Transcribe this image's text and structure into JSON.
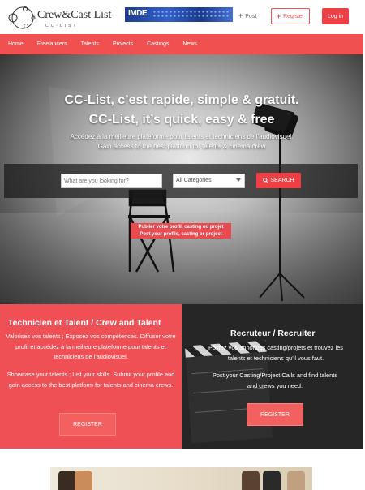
{
  "header": {
    "logo_title": "Crew&Cast List",
    "logo_sub": "CC-LIST",
    "banner_text": "IMDE",
    "post_label": "Post",
    "register_label": "Register",
    "login_label": "Log in"
  },
  "nav": {
    "items": [
      "Home",
      "Freelancers",
      "Talents",
      "Projects",
      "Castings",
      "News"
    ]
  },
  "hero": {
    "title_fr": "CC-List, c’est rapide, simple & gratuit.",
    "title_en": "CC-List, it’s quick, easy & free",
    "sub_fr": "Accédez à la meilleure plateforme pour talents et techniciens de l’audiovisuel.",
    "sub_en": "Gain access to the best platform for talents & cinema crew",
    "search_placeholder": "What are you looking for?",
    "category_selected": "All Categories",
    "search_label": "SEARCH",
    "post_btn_fr": "Publier votre profil, casting ou projet",
    "post_btn_en": "Post your profile, casting or project"
  },
  "panel_left": {
    "title": "Technicien et Talent / Crew and Talent",
    "text_fr": "Valorisez vos talents ; Exposez vos compétences. Diffuser votre profil et accédez à la meilleure plateforme pour talents et techniciens de l’audiovisuel.",
    "text_en": "Showcase your talents ; List your skills. Submit your profile and gain access to the best platform for talents and cinema crews.",
    "button": "REGISTER"
  },
  "panel_right": {
    "title": "Recruteur / Recruiter",
    "text_fr": "Postez vos annonces casting/projets et trouvez les talents et techniciens qu’il vous faut.",
    "text_en": "Post your Casting/Project Calls and find talents and crews you need.",
    "button": "REGISTER"
  },
  "colors": {
    "accent": "#ef3f45",
    "nav_bg": "#f15050",
    "panel_left_bg": "#ef5055",
    "panel_right_bg": "#262626"
  }
}
